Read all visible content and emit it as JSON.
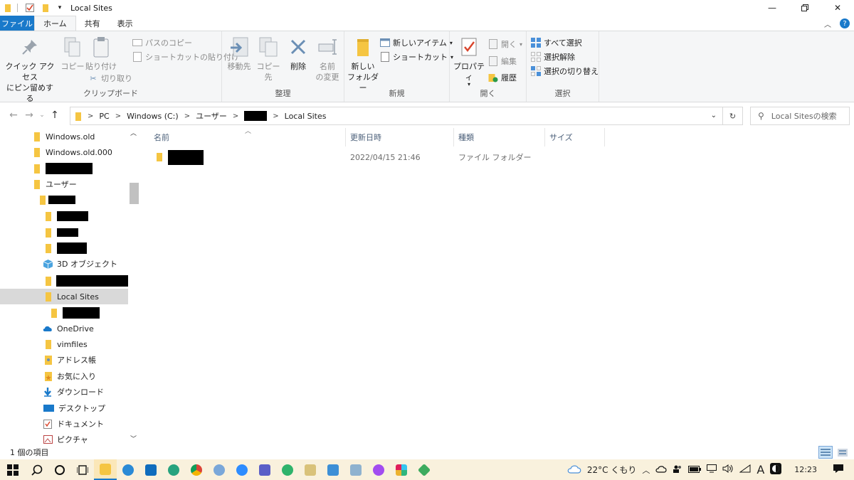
{
  "window": {
    "title": "Local Sites"
  },
  "tabs": {
    "file": "ファイル",
    "home": "ホーム",
    "share": "共有",
    "view": "表示"
  },
  "ribbon": {
    "clipboard": {
      "label": "クリップボード",
      "pin": "クイック アクセス\nにピン留めする",
      "pin_line1": "クイック アクセス",
      "pin_line2": "にピン留めする",
      "copy": "コピー",
      "paste": "貼り付け",
      "copy_path": "パスのコピー",
      "paste_shortcut": "ショートカットの貼り付け",
      "cut": "切り取り"
    },
    "organize": {
      "label": "整理",
      "move_to": "移動先",
      "copy_to": "コピー先",
      "delete": "削除",
      "rename_line1": "名前",
      "rename_line2": "の変更"
    },
    "new": {
      "label": "新規",
      "new_folder_line1": "新しい",
      "new_folder_line2": "フォルダー",
      "new_item": "新しいアイテム",
      "shortcut": "ショートカット"
    },
    "open": {
      "label": "開く",
      "properties": "プロパティ",
      "open": "開く",
      "edit": "編集",
      "history": "履歴"
    },
    "select": {
      "label": "選択",
      "select_all": "すべて選択",
      "select_none": "選択解除",
      "invert": "選択の切り替え"
    }
  },
  "address": {
    "crumbs": [
      "PC",
      "Windows (C:)",
      "ユーザー",
      "",
      "Local Sites"
    ],
    "search_placeholder": "Local Sitesの検索"
  },
  "nav_tree": [
    {
      "label": "Windows.old"
    },
    {
      "label": "Windows.old.000"
    },
    {
      "label": ""
    },
    {
      "label": "ユーザー"
    },
    {
      "label": ""
    },
    {
      "label": ""
    },
    {
      "label": ""
    },
    {
      "label": ""
    },
    {
      "label": "3D オブジェクト"
    },
    {
      "label": ""
    },
    {
      "label": "Local Sites"
    },
    {
      "label": ""
    },
    {
      "label": "OneDrive"
    },
    {
      "label": "vimfiles"
    },
    {
      "label": "アドレス帳"
    },
    {
      "label": "お気に入り"
    },
    {
      "label": "ダウンロード"
    },
    {
      "label": "デスクトップ"
    },
    {
      "label": "ドキュメント"
    },
    {
      "label": "ピクチャ"
    }
  ],
  "columns": {
    "name": "名前",
    "modified": "更新日時",
    "type": "種類",
    "size": "サイズ"
  },
  "files": [
    {
      "name": "",
      "modified": "2022/04/15 21:46",
      "type": "ファイル フォルダー",
      "size": ""
    }
  ],
  "status": {
    "item_count": "1 個の項目"
  },
  "taskbar": {
    "weather": "22°C くもり",
    "ime": "A",
    "time": "12:23"
  },
  "colors": {
    "accent": "#1979ca",
    "folder": "#f5c542",
    "taskbar": "#f9f1dd"
  }
}
